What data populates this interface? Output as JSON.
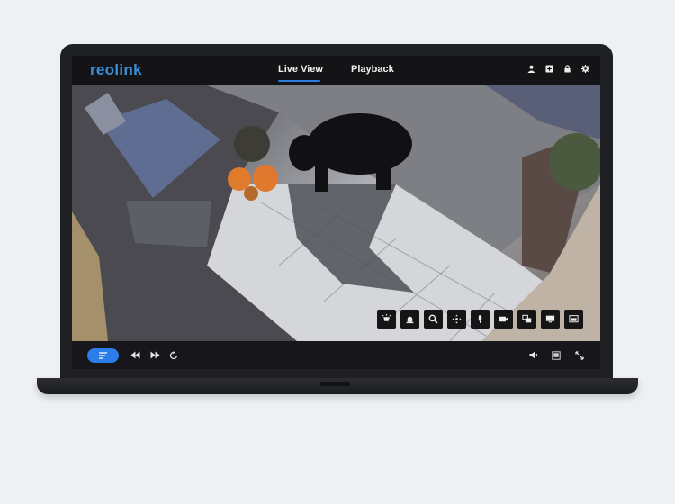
{
  "app": {
    "logo_text": "reolink",
    "brand_color": "#3a8fd8",
    "accent_color": "#2b7de9"
  },
  "header": {
    "tabs": [
      {
        "label": "Live View",
        "active": true
      },
      {
        "label": "Playback",
        "active": false
      }
    ],
    "icons": [
      "user-icon",
      "add-device-icon",
      "lock-icon",
      "settings-gear-icon"
    ]
  },
  "video": {
    "scene": "Security camera live feed: black bear on a stone patio next to pumpkins, a table and chairs",
    "overlay_controls": [
      "spotlight-icon",
      "siren-bell-icon",
      "zoom-magnifier-icon",
      "ptz-move-icon",
      "microphone-icon",
      "record-video-icon",
      "snapshot-icon",
      "display-mode-icon",
      "cast-screen-icon"
    ]
  },
  "footer": {
    "left_controls": [
      "menu-list-icon",
      "rewind-icon",
      "fast-forward-icon",
      "refresh-icon"
    ],
    "right_controls": [
      "volume-icon",
      "screen-layout-icon",
      "fullscreen-icon"
    ]
  }
}
